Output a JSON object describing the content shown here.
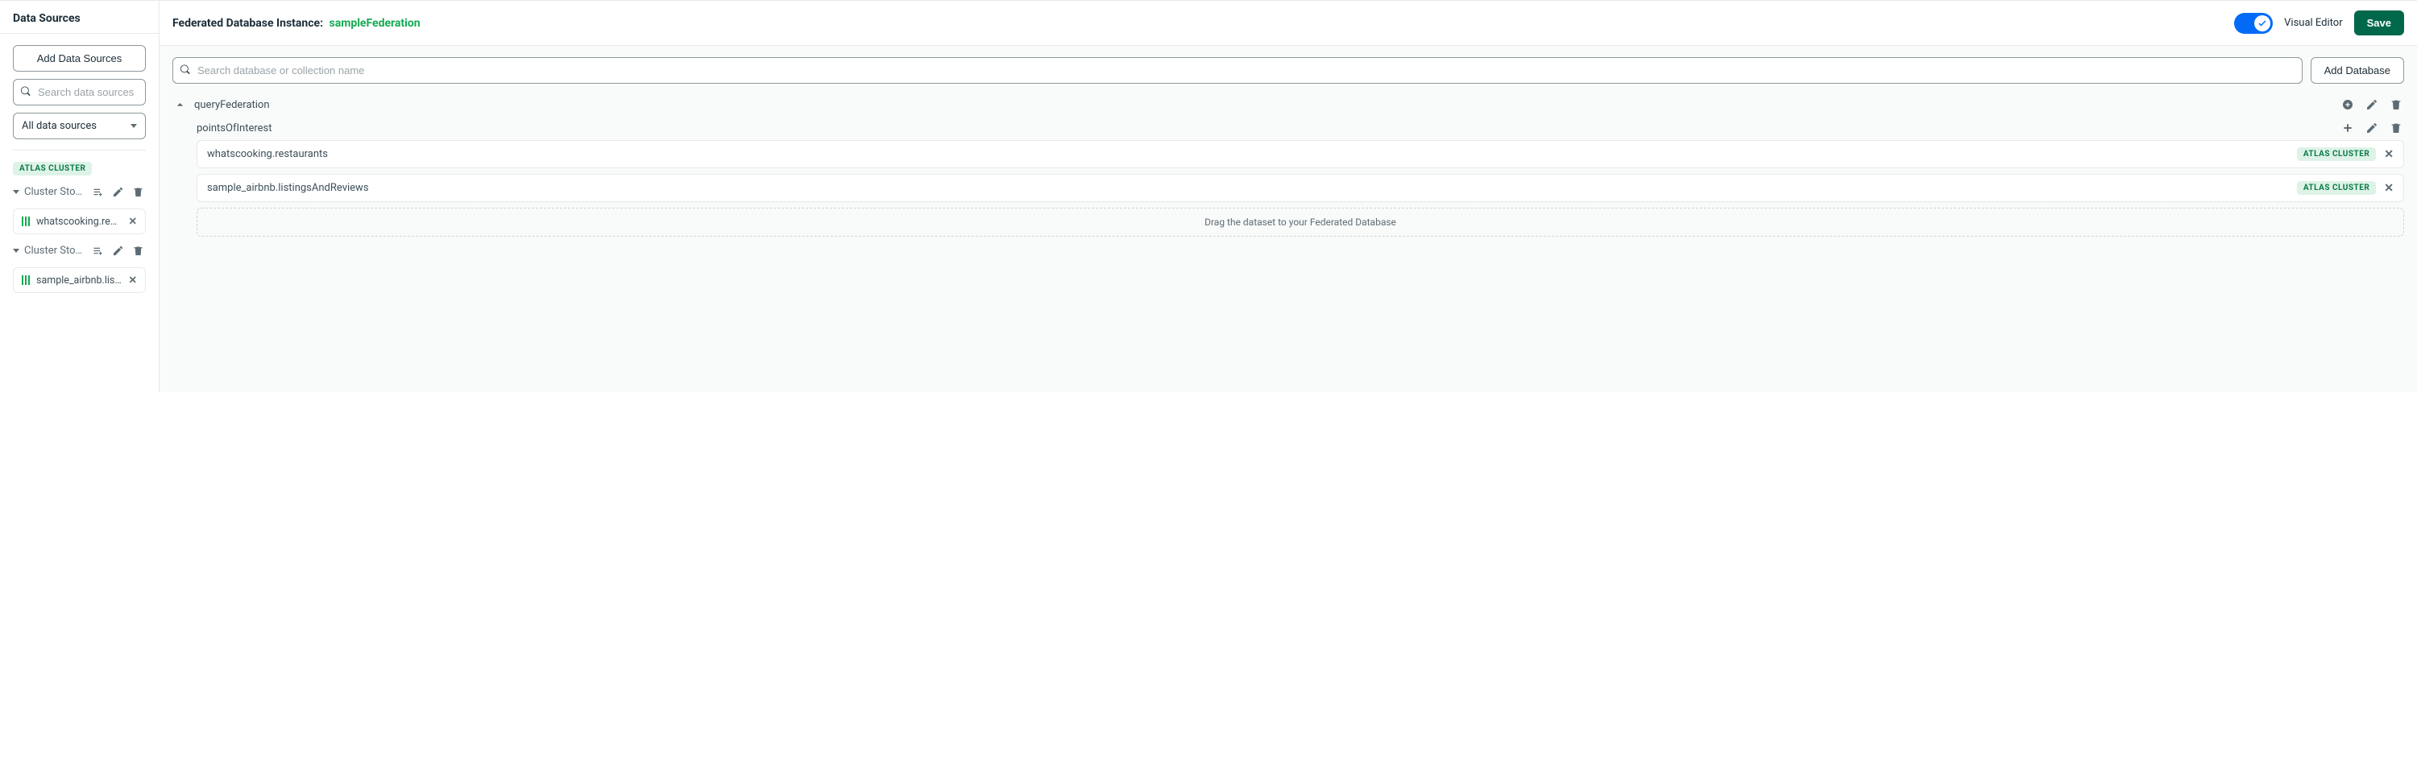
{
  "sidebar": {
    "title": "Data Sources",
    "add_button": "Add Data Sources",
    "search_placeholder": "Search data sources",
    "filter_selected": "All data sources",
    "cluster_label": "ATLAS CLUSTER",
    "stores": [
      {
        "label": "Cluster Store: cluster-WhatsCooki...",
        "datasets": [
          "whatscooking.restaurants"
        ]
      },
      {
        "label": "Cluster Store: cluster-AirBNB",
        "datasets": [
          "sample_airbnb.listingsAndReviews"
        ]
      }
    ]
  },
  "main": {
    "title_prefix": "Federated Database Instance:",
    "instance_name": "sampleFederation",
    "toggle_label": "Visual Editor",
    "save_label": "Save",
    "search_placeholder": "Search database or collection name",
    "add_db_label": "Add Database",
    "database": {
      "name": "queryFederation",
      "collection": {
        "name": "pointsOfInterest",
        "mapped": [
          {
            "name": "whatscooking.restaurants",
            "tag": "ATLAS CLUSTER"
          },
          {
            "name": "sample_airbnb.listingsAndReviews",
            "tag": "ATLAS CLUSTER"
          }
        ],
        "drop_hint": "Drag the dataset to your Federated Database"
      }
    }
  }
}
